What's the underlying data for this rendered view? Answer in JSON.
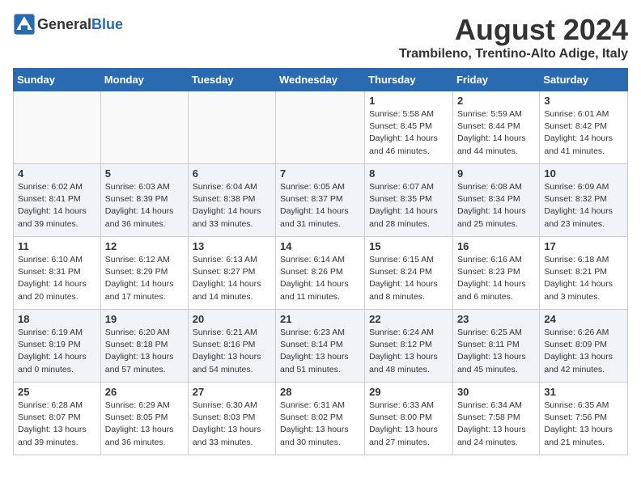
{
  "header": {
    "logo_general": "General",
    "logo_blue": "Blue",
    "month_year": "August 2024",
    "location": "Trambileno, Trentino-Alto Adige, Italy"
  },
  "weekdays": [
    "Sunday",
    "Monday",
    "Tuesday",
    "Wednesday",
    "Thursday",
    "Friday",
    "Saturday"
  ],
  "weeks": [
    [
      {
        "day": "",
        "info": ""
      },
      {
        "day": "",
        "info": ""
      },
      {
        "day": "",
        "info": ""
      },
      {
        "day": "",
        "info": ""
      },
      {
        "day": "1",
        "info": "Sunrise: 5:58 AM\nSunset: 8:45 PM\nDaylight: 14 hours\nand 46 minutes."
      },
      {
        "day": "2",
        "info": "Sunrise: 5:59 AM\nSunset: 8:44 PM\nDaylight: 14 hours\nand 44 minutes."
      },
      {
        "day": "3",
        "info": "Sunrise: 6:01 AM\nSunset: 8:42 PM\nDaylight: 14 hours\nand 41 minutes."
      }
    ],
    [
      {
        "day": "4",
        "info": "Sunrise: 6:02 AM\nSunset: 8:41 PM\nDaylight: 14 hours\nand 39 minutes."
      },
      {
        "day": "5",
        "info": "Sunrise: 6:03 AM\nSunset: 8:39 PM\nDaylight: 14 hours\nand 36 minutes."
      },
      {
        "day": "6",
        "info": "Sunrise: 6:04 AM\nSunset: 8:38 PM\nDaylight: 14 hours\nand 33 minutes."
      },
      {
        "day": "7",
        "info": "Sunrise: 6:05 AM\nSunset: 8:37 PM\nDaylight: 14 hours\nand 31 minutes."
      },
      {
        "day": "8",
        "info": "Sunrise: 6:07 AM\nSunset: 8:35 PM\nDaylight: 14 hours\nand 28 minutes."
      },
      {
        "day": "9",
        "info": "Sunrise: 6:08 AM\nSunset: 8:34 PM\nDaylight: 14 hours\nand 25 minutes."
      },
      {
        "day": "10",
        "info": "Sunrise: 6:09 AM\nSunset: 8:32 PM\nDaylight: 14 hours\nand 23 minutes."
      }
    ],
    [
      {
        "day": "11",
        "info": "Sunrise: 6:10 AM\nSunset: 8:31 PM\nDaylight: 14 hours\nand 20 minutes."
      },
      {
        "day": "12",
        "info": "Sunrise: 6:12 AM\nSunset: 8:29 PM\nDaylight: 14 hours\nand 17 minutes."
      },
      {
        "day": "13",
        "info": "Sunrise: 6:13 AM\nSunset: 8:27 PM\nDaylight: 14 hours\nand 14 minutes."
      },
      {
        "day": "14",
        "info": "Sunrise: 6:14 AM\nSunset: 8:26 PM\nDaylight: 14 hours\nand 11 minutes."
      },
      {
        "day": "15",
        "info": "Sunrise: 6:15 AM\nSunset: 8:24 PM\nDaylight: 14 hours\nand 8 minutes."
      },
      {
        "day": "16",
        "info": "Sunrise: 6:16 AM\nSunset: 8:23 PM\nDaylight: 14 hours\nand 6 minutes."
      },
      {
        "day": "17",
        "info": "Sunrise: 6:18 AM\nSunset: 8:21 PM\nDaylight: 14 hours\nand 3 minutes."
      }
    ],
    [
      {
        "day": "18",
        "info": "Sunrise: 6:19 AM\nSunset: 8:19 PM\nDaylight: 14 hours\nand 0 minutes."
      },
      {
        "day": "19",
        "info": "Sunrise: 6:20 AM\nSunset: 8:18 PM\nDaylight: 13 hours\nand 57 minutes."
      },
      {
        "day": "20",
        "info": "Sunrise: 6:21 AM\nSunset: 8:16 PM\nDaylight: 13 hours\nand 54 minutes."
      },
      {
        "day": "21",
        "info": "Sunrise: 6:23 AM\nSunset: 8:14 PM\nDaylight: 13 hours\nand 51 minutes."
      },
      {
        "day": "22",
        "info": "Sunrise: 6:24 AM\nSunset: 8:12 PM\nDaylight: 13 hours\nand 48 minutes."
      },
      {
        "day": "23",
        "info": "Sunrise: 6:25 AM\nSunset: 8:11 PM\nDaylight: 13 hours\nand 45 minutes."
      },
      {
        "day": "24",
        "info": "Sunrise: 6:26 AM\nSunset: 8:09 PM\nDaylight: 13 hours\nand 42 minutes."
      }
    ],
    [
      {
        "day": "25",
        "info": "Sunrise: 6:28 AM\nSunset: 8:07 PM\nDaylight: 13 hours\nand 39 minutes."
      },
      {
        "day": "26",
        "info": "Sunrise: 6:29 AM\nSunset: 8:05 PM\nDaylight: 13 hours\nand 36 minutes."
      },
      {
        "day": "27",
        "info": "Sunrise: 6:30 AM\nSunset: 8:03 PM\nDaylight: 13 hours\nand 33 minutes."
      },
      {
        "day": "28",
        "info": "Sunrise: 6:31 AM\nSunset: 8:02 PM\nDaylight: 13 hours\nand 30 minutes."
      },
      {
        "day": "29",
        "info": "Sunrise: 6:33 AM\nSunset: 8:00 PM\nDaylight: 13 hours\nand 27 minutes."
      },
      {
        "day": "30",
        "info": "Sunrise: 6:34 AM\nSunset: 7:58 PM\nDaylight: 13 hours\nand 24 minutes."
      },
      {
        "day": "31",
        "info": "Sunrise: 6:35 AM\nSunset: 7:56 PM\nDaylight: 13 hours\nand 21 minutes."
      }
    ]
  ]
}
